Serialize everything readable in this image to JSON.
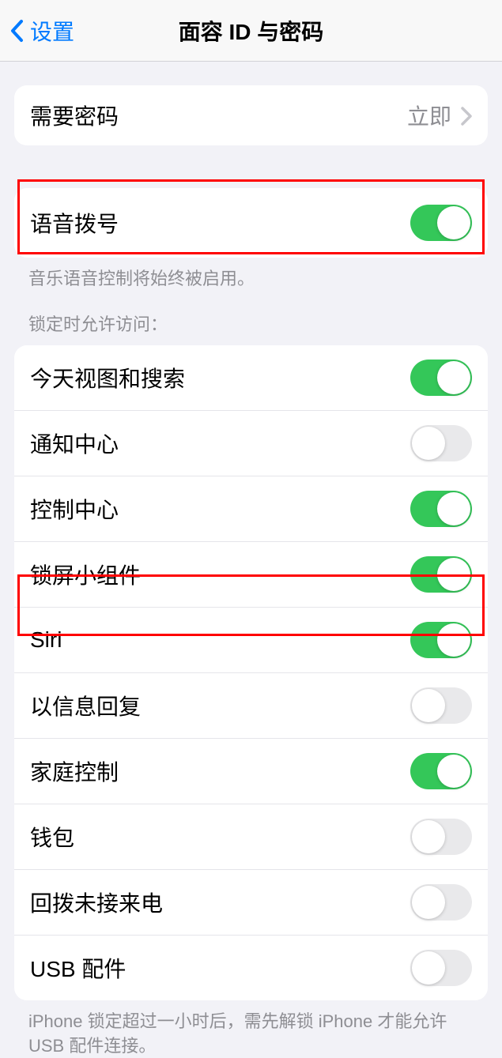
{
  "header": {
    "back_label": "设置",
    "title": "面容 ID 与密码"
  },
  "require_passcode": {
    "label": "需要密码",
    "value": "立即"
  },
  "voice_dial": {
    "label": "语音拨号",
    "on": true,
    "footer": "音乐语音控制将始终被启用。"
  },
  "lock_access": {
    "header": "锁定时允许访问：",
    "items": [
      {
        "label": "今天视图和搜索",
        "on": true
      },
      {
        "label": "通知中心",
        "on": false
      },
      {
        "label": "控制中心",
        "on": true
      },
      {
        "label": "锁屏小组件",
        "on": true
      },
      {
        "label": "Siri",
        "on": true
      },
      {
        "label": "以信息回复",
        "on": false
      },
      {
        "label": "家庭控制",
        "on": true
      },
      {
        "label": "钱包",
        "on": false
      },
      {
        "label": "回拨未接来电",
        "on": false
      },
      {
        "label": "USB 配件",
        "on": false
      }
    ],
    "footer": "iPhone 锁定超过一小时后，需先解锁 iPhone 才能允许USB 配件连接。"
  }
}
